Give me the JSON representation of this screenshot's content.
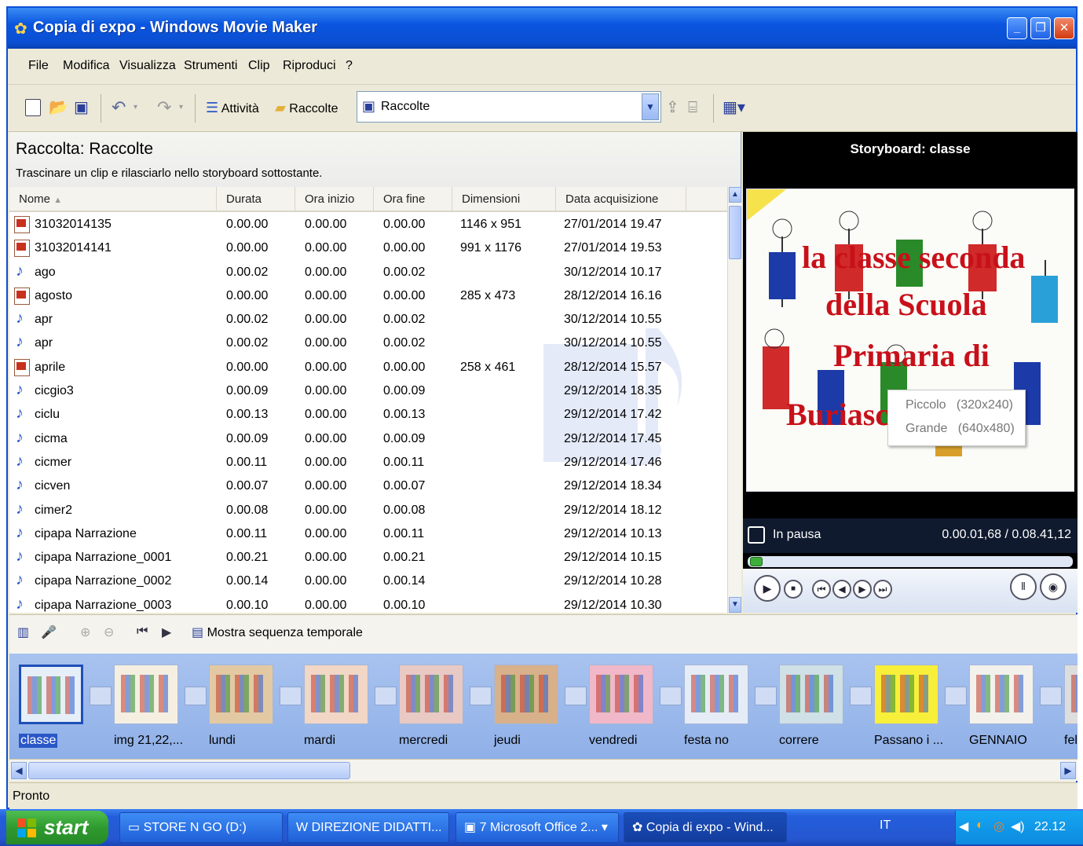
{
  "window": {
    "title": "Copia di expo - Windows Movie Maker",
    "buttons": [
      "_",
      "❐",
      "✕"
    ]
  },
  "menu": [
    "File",
    "Modifica",
    "Visualizza",
    "Strumenti",
    "Clip",
    "Riproduci",
    "?"
  ],
  "toolbar": {
    "tasks_label": "Attività",
    "collections_label": "Raccolte",
    "combo_value": "Raccolte"
  },
  "collection": {
    "title": "Raccolta: Raccolte",
    "hint": "Trascinare un clip e rilasciarlo nello storyboard sottostante.",
    "columns": [
      "Nome",
      "Durata",
      "Ora inizio",
      "Ora fine",
      "Dimensioni",
      "Data acquisizione"
    ],
    "rows": [
      {
        "type": "img",
        "name": "31032014135",
        "dur": "0.00.00",
        "start": "0.00.00",
        "end": "0.00.00",
        "dim": "1146 x 951",
        "date": "27/01/2014 19.47"
      },
      {
        "type": "img",
        "name": "31032014141",
        "dur": "0.00.00",
        "start": "0.00.00",
        "end": "0.00.00",
        "dim": "991 x 1176",
        "date": "27/01/2014 19.53"
      },
      {
        "type": "aud",
        "name": "ago",
        "dur": "0.00.02",
        "start": "0.00.00",
        "end": "0.00.02",
        "dim": "",
        "date": "30/12/2014 10.17"
      },
      {
        "type": "img",
        "name": "agosto",
        "dur": "0.00.00",
        "start": "0.00.00",
        "end": "0.00.00",
        "dim": "285 x 473",
        "date": "28/12/2014 16.16"
      },
      {
        "type": "aud",
        "name": "apr",
        "dur": "0.00.02",
        "start": "0.00.00",
        "end": "0.00.02",
        "dim": "",
        "date": "30/12/2014 10.55"
      },
      {
        "type": "aud",
        "name": "apr",
        "dur": "0.00.02",
        "start": "0.00.00",
        "end": "0.00.02",
        "dim": "",
        "date": "30/12/2014 10.55"
      },
      {
        "type": "img",
        "name": "aprile",
        "dur": "0.00.00",
        "start": "0.00.00",
        "end": "0.00.00",
        "dim": "258 x 461",
        "date": "28/12/2014 15.57"
      },
      {
        "type": "aud",
        "name": "cicgio3",
        "dur": "0.00.09",
        "start": "0.00.00",
        "end": "0.00.09",
        "dim": "",
        "date": "29/12/2014 18.35"
      },
      {
        "type": "aud",
        "name": "ciclu",
        "dur": "0.00.13",
        "start": "0.00.00",
        "end": "0.00.13",
        "dim": "",
        "date": "29/12/2014 17.42"
      },
      {
        "type": "aud",
        "name": "cicma",
        "dur": "0.00.09",
        "start": "0.00.00",
        "end": "0.00.09",
        "dim": "",
        "date": "29/12/2014 17.45"
      },
      {
        "type": "aud",
        "name": "cicmer",
        "dur": "0.00.11",
        "start": "0.00.00",
        "end": "0.00.11",
        "dim": "",
        "date": "29/12/2014 17.46"
      },
      {
        "type": "aud",
        "name": "cicven",
        "dur": "0.00.07",
        "start": "0.00.00",
        "end": "0.00.07",
        "dim": "",
        "date": "29/12/2014 18.34"
      },
      {
        "type": "aud",
        "name": "cimer2",
        "dur": "0.00.08",
        "start": "0.00.00",
        "end": "0.00.08",
        "dim": "",
        "date": "29/12/2014 18.12"
      },
      {
        "type": "aud",
        "name": "cipapa Narrazione",
        "dur": "0.00.11",
        "start": "0.00.00",
        "end": "0.00.11",
        "dim": "",
        "date": "29/12/2014 10.13"
      },
      {
        "type": "aud",
        "name": "cipapa Narrazione_0001",
        "dur": "0.00.21",
        "start": "0.00.00",
        "end": "0.00.21",
        "dim": "",
        "date": "29/12/2014 10.15"
      },
      {
        "type": "aud",
        "name": "cipapa Narrazione_0002",
        "dur": "0.00.14",
        "start": "0.00.00",
        "end": "0.00.14",
        "dim": "",
        "date": "29/12/2014 10.28"
      },
      {
        "type": "aud",
        "name": "cipapa Narrazione_0003",
        "dur": "0.00.10",
        "start": "0.00.00",
        "end": "0.00.10",
        "dim": "",
        "date": "29/12/2014 10.30"
      }
    ]
  },
  "preview": {
    "title": "Storyboard: classe",
    "drawing_lines": [
      "la classe seconda",
      "della Scuola",
      "Primaria di",
      "Buriasco"
    ],
    "status": "In pausa",
    "time": "0.00.01,68 / 0.08.41,12",
    "position_fraction": 0.003
  },
  "popup": {
    "items": [
      {
        "label": "Piccolo",
        "size": "(320x240)"
      },
      {
        "label": "Grande",
        "size": "(640x480)"
      }
    ]
  },
  "timeline": {
    "toggle_label": "Mostra sequenza temporale"
  },
  "clips": [
    {
      "label": "classe",
      "color": "#e6eef8",
      "selected": true
    },
    {
      "label": "img 21,22,...",
      "color": "#f5efe2"
    },
    {
      "label": "lundi",
      "color": "#e3c9a3"
    },
    {
      "label": "mardi",
      "color": "#f2d6c6"
    },
    {
      "label": "mercredi",
      "color": "#e8c9c4"
    },
    {
      "label": "jeudi",
      "color": "#d8b08a"
    },
    {
      "label": "vendredi",
      "color": "#f0b8c8"
    },
    {
      "label": "festa no",
      "color": "#e6ecf6"
    },
    {
      "label": "correre",
      "color": "#cfe0e6"
    },
    {
      "label": "Passano i ...",
      "color": "#f7ef3a"
    },
    {
      "label": "GENNAIO",
      "color": "#f3f1ec"
    },
    {
      "label": "fel",
      "color": "#dddddd"
    }
  ],
  "status_text": "Pronto",
  "taskbar": {
    "start": "start",
    "tasks": [
      "STORE N GO (D:)",
      "DIREZIONE DIDATTI...",
      "7 Microsoft Office 2...",
      "Copia di expo - Wind..."
    ],
    "lang": "IT",
    "clock": "22.12"
  },
  "colors": {
    "titlebar": "#0a55e0",
    "storyboard": "#9db9ec",
    "taskbar": "#245edb",
    "start": "#2f9a2f"
  }
}
